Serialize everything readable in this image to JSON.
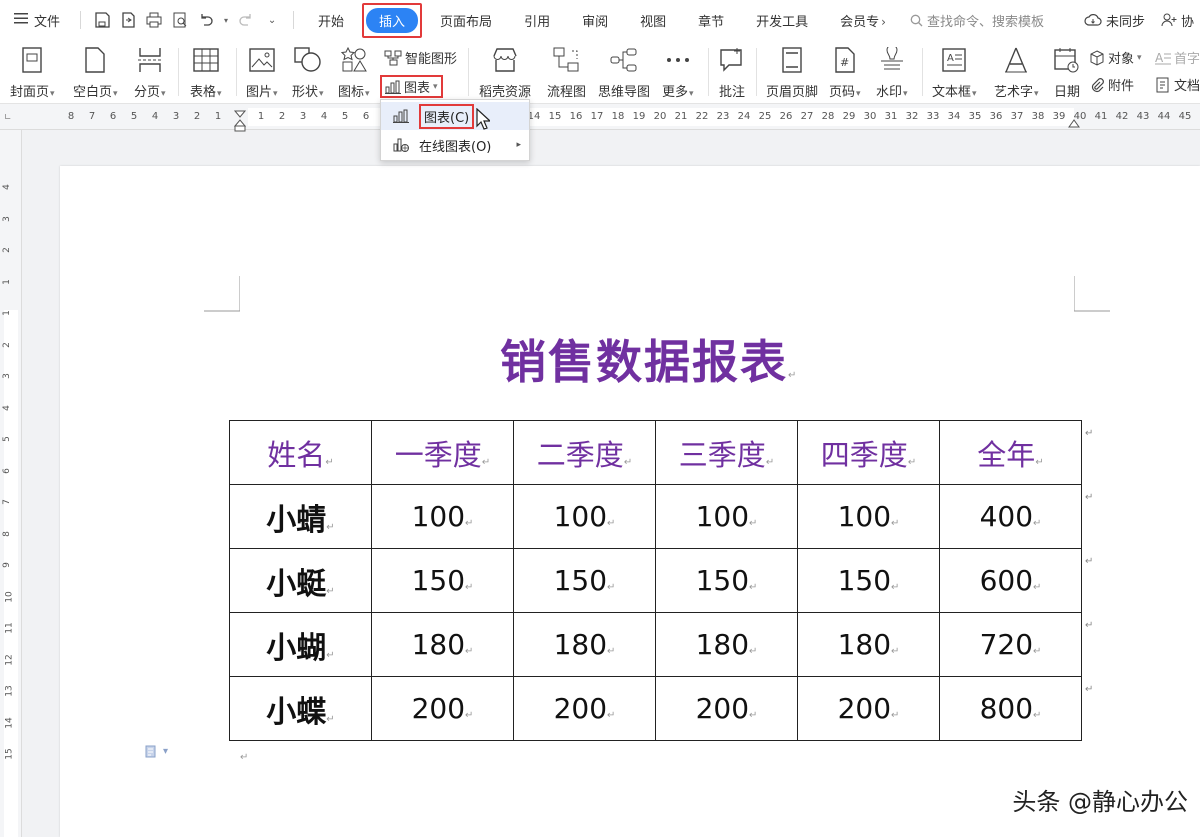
{
  "app": {
    "file_menu": "文件",
    "tabs": [
      "开始",
      "插入",
      "页面布局",
      "引用",
      "审阅",
      "视图",
      "章节",
      "开发工具",
      "会员专"
    ],
    "active_tab": "插入",
    "search_placeholder": "查找命令、搜索模板",
    "sync_label": "未同步",
    "collab_label": "协"
  },
  "ribbon": {
    "cover": "封面页",
    "blank": "空白页",
    "page_break": "分页",
    "table": "表格",
    "picture": "图片",
    "shape": "形状",
    "icons": "图标",
    "smart_art": "智能图形",
    "chart": "图表",
    "docer": "稻壳资源",
    "flowchart": "流程图",
    "mindmap": "思维导图",
    "more": "更多",
    "comment": "批注",
    "header_footer": "页眉页脚",
    "page_number": "页码",
    "watermark": "水印",
    "textbox": "文本框",
    "wordart": "艺术字",
    "date": "日期",
    "object": "对象",
    "attachment": "附件",
    "drop_cap": "首字",
    "doc": "文档"
  },
  "dropdown": {
    "items": [
      {
        "label": "图表(C)"
      },
      {
        "label": "在线图表(O)"
      }
    ]
  },
  "ruler": {
    "left_ticks": [
      "8",
      "7",
      "6",
      "5",
      "4",
      "3",
      "2",
      "1"
    ],
    "right_ticks": [
      "1",
      "2",
      "3",
      "4",
      "5",
      "6",
      "7",
      "8",
      "9",
      "10",
      "11",
      "12",
      "13",
      "14",
      "15",
      "16",
      "17",
      "18",
      "19",
      "20",
      "21",
      "22",
      "23",
      "24",
      "25",
      "26",
      "27",
      "28",
      "29",
      "30",
      "31",
      "32",
      "33",
      "34",
      "35",
      "36",
      "37",
      "38",
      "39",
      "40",
      "41",
      "42",
      "43",
      "44",
      "45"
    ],
    "vertical_ticks": [
      "4",
      "3",
      "2",
      "1",
      "1",
      "2",
      "3",
      "4",
      "5",
      "6",
      "7",
      "8",
      "9",
      "10",
      "11",
      "12",
      "13",
      "14",
      "15"
    ]
  },
  "document": {
    "title": "销售数据报表",
    "table": {
      "header": [
        "姓名",
        "一季度",
        "二季度",
        "三季度",
        "四季度",
        "全年"
      ],
      "rows": [
        [
          "小蜻",
          "100",
          "100",
          "100",
          "100",
          "400"
        ],
        [
          "小蜓",
          "150",
          "150",
          "150",
          "150",
          "600"
        ],
        [
          "小蝴",
          "180",
          "180",
          "180",
          "180",
          "720"
        ],
        [
          "小蝶",
          "200",
          "200",
          "200",
          "200",
          "800"
        ]
      ]
    },
    "para_mark": "↵",
    "watermark": "头条 @静心办公"
  },
  "colors": {
    "accent": "#2c83f4",
    "title_color": "#7030a0",
    "highlight_red": "#e23a3a"
  }
}
